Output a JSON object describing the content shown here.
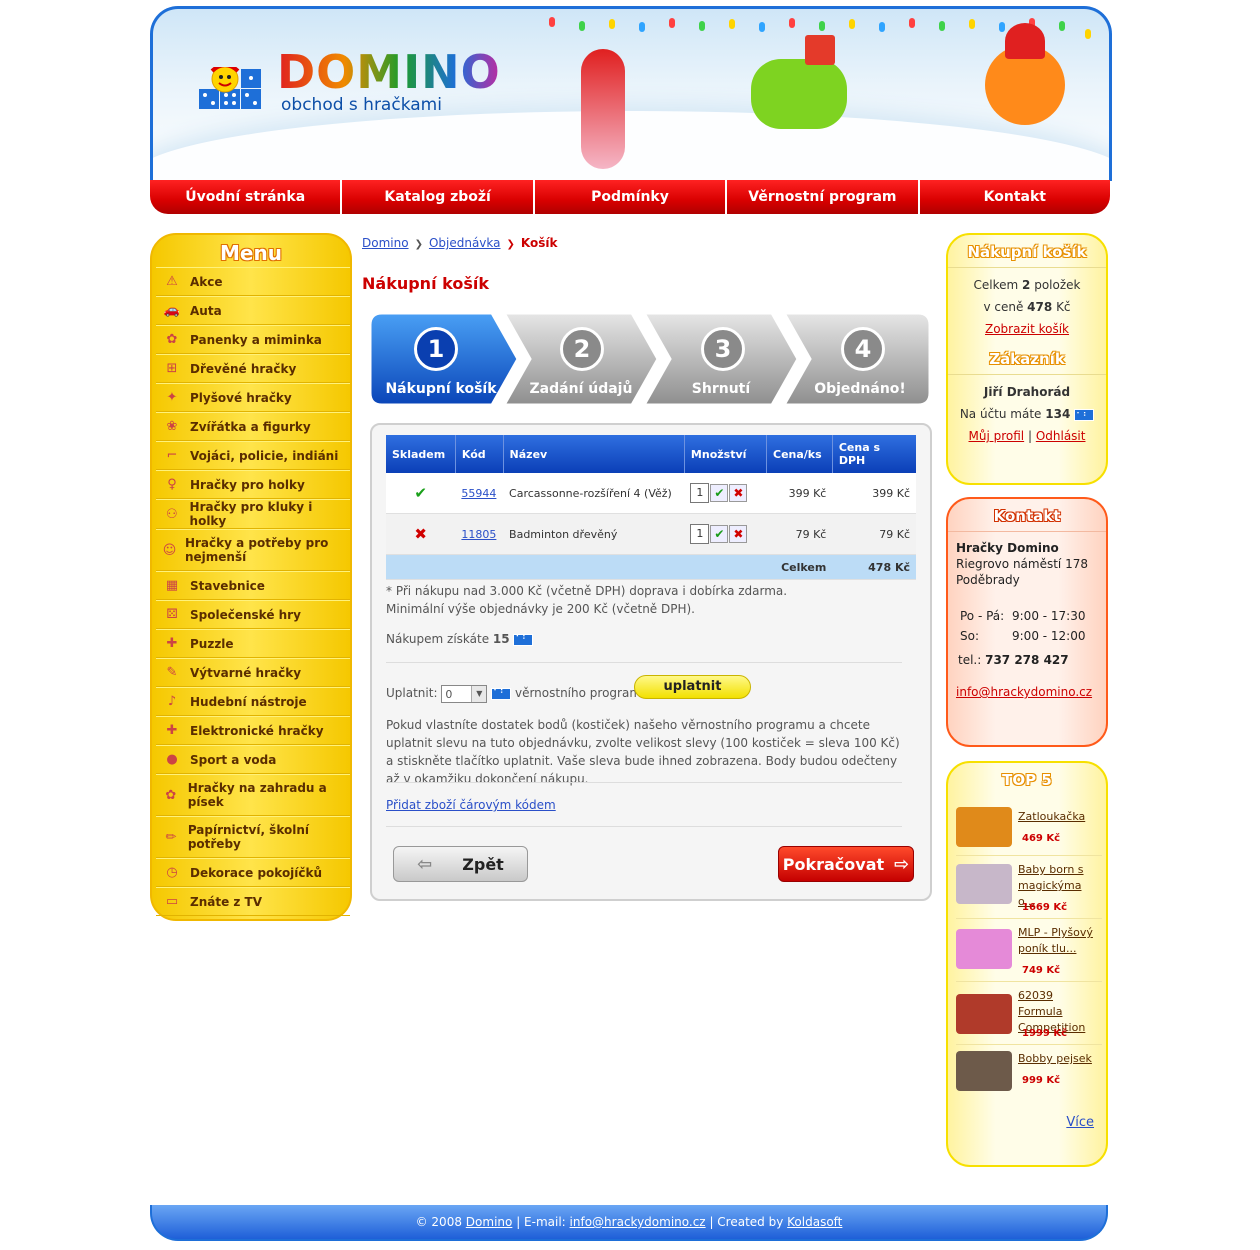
{
  "header": {
    "logo_title": "DOMINO",
    "logo_subtitle": "obchod s hračkami"
  },
  "nav": [
    {
      "label": "Úvodní stránka"
    },
    {
      "label": "Katalog zboží"
    },
    {
      "label": "Podmínky"
    },
    {
      "label": "Věrnostní program"
    },
    {
      "label": "Kontakt"
    }
  ],
  "menu": {
    "title": "Menu",
    "items": [
      {
        "label": "Akce",
        "icon": "warning-icon"
      },
      {
        "label": "Auta",
        "icon": "car-icon"
      },
      {
        "label": "Panenky a miminka",
        "icon": "doll-icon"
      },
      {
        "label": "Dřevěné hračky",
        "icon": "train-icon"
      },
      {
        "label": "Plyšové hračky",
        "icon": "teddy-icon"
      },
      {
        "label": "Zvířátka a figurky",
        "icon": "animal-icon"
      },
      {
        "label": "Vojáci, policie, indiáni",
        "icon": "gun-icon"
      },
      {
        "label": "Hračky pro holky",
        "icon": "girl-icon"
      },
      {
        "label": "Hračky pro kluky i holky",
        "icon": "kids-icon"
      },
      {
        "label": "Hračky a potřeby pro nejmenší",
        "icon": "baby-icon"
      },
      {
        "label": "Stavebnice",
        "icon": "blocks-icon"
      },
      {
        "label": "Společenské hry",
        "icon": "dice-icon"
      },
      {
        "label": "Puzzle",
        "icon": "puzzle-icon"
      },
      {
        "label": "Výtvarné hračky",
        "icon": "palette-icon"
      },
      {
        "label": "Hudební nástroje",
        "icon": "music-icon"
      },
      {
        "label": "Elektronické hračky",
        "icon": "electronic-icon"
      },
      {
        "label": "Sport a voda",
        "icon": "ball-icon"
      },
      {
        "label": "Hračky na zahradu a písek",
        "icon": "garden-icon"
      },
      {
        "label": "Papírnictví, školní potřeby",
        "icon": "pencil-icon"
      },
      {
        "label": "Dekorace pokojíčků",
        "icon": "clock-icon"
      },
      {
        "label": "Znáte z TV",
        "icon": "tv-icon"
      }
    ]
  },
  "breadcrumb": {
    "items": [
      "Domino",
      "Objednávka"
    ],
    "current": "Košík"
  },
  "page_title": "Nákupní košík",
  "steps": [
    {
      "num": "1",
      "label": "Nákupní košík",
      "active": true
    },
    {
      "num": "2",
      "label": "Zadání údajů",
      "active": false
    },
    {
      "num": "3",
      "label": "Shrnutí",
      "active": false
    },
    {
      "num": "4",
      "label": "Objednáno!",
      "active": false
    }
  ],
  "cart": {
    "columns": [
      "Skladem",
      "Kód",
      "Název",
      "Množství",
      "Cena/ks",
      "Cena s DPH"
    ],
    "rows": [
      {
        "in_stock": true,
        "code": "55944",
        "name": "Carcassonne-rozšíření 4 (Věž)",
        "qty": "1",
        "unit_price": "399 Kč",
        "price_vat": "399 Kč"
      },
      {
        "in_stock": false,
        "code": "11805",
        "name": "Badminton dřevěný",
        "qty": "1",
        "unit_price": "79 Kč",
        "price_vat": "79 Kč"
      }
    ],
    "total_label": "Celkem",
    "total_value": "478 Kč",
    "note_line1": "* Při nákupu nad 3.000 Kč (včetně DPH) doprava i dobírka zdarma.",
    "note_line2": "Minimální výše objednávky je 200 Kč (včetně DPH).",
    "points_text": "Nákupem získáte",
    "points_value": "15",
    "redeem_label": "Uplatnit:",
    "redeem_value": "0",
    "redeem_suffix": "věrnostního programu",
    "redeem_button": "uplatnit",
    "redeem_info": "Pokud vlastníte dostatek bodů (kostiček) našeho věrnostního programu a chcete uplatnit slevu na tuto objednávku, zvolte velikost slevy (100 kostiček = sleva 100 Kč) a stiskněte tlačítko uplatnit. Vaše sleva bude ihned zobrazena. Body budou odečteny až v okamžiku dokončení nákupu.",
    "barcode_link": "Přidat zboží čárovým kódem",
    "back_button": "Zpět",
    "next_button": "Pokračovat"
  },
  "cart_box": {
    "title": "Nákupní košík",
    "line1_pre": "Celkem",
    "line1_count": "2",
    "line1_post": "položek",
    "line2_pre": "v ceně",
    "line2_price": "478",
    "line2_post": "Kč",
    "link": "Zobrazit košík"
  },
  "customer_box": {
    "title": "Zákazník",
    "name": "Jiří Drahorád",
    "points_pre": "Na účtu máte",
    "points_value": "134",
    "profile_link": "Můj profil",
    "logout_link": "Odhlásit"
  },
  "contact_box": {
    "title": "Kontakt",
    "company": "Hračky Domino",
    "street": "Riegrovo náměstí 178",
    "city": "Poděbrady",
    "hours1_days": "Po - Pá:",
    "hours1_time": "9:00 - 17:30",
    "hours2_days": "So:",
    "hours2_time": "9:00 - 12:00",
    "phone_label": "tel.:",
    "phone": "737 278 427",
    "email": "info@hrackydomino.cz"
  },
  "top5": {
    "title": "TOP 5",
    "items": [
      {
        "name": "Zatloukačka",
        "price": "469 Kč",
        "color": "#e08a1a"
      },
      {
        "name": "Baby born s magickýma o...",
        "price": "1669 Kč",
        "color": "#c7b7c9"
      },
      {
        "name": "MLP - Plyšový poník tlu...",
        "price": "749 Kč",
        "color": "#e58ad8"
      },
      {
        "name": "62039 Formula Competition",
        "price": "1999 Kč",
        "color": "#b03a2a"
      },
      {
        "name": "Bobby pejsek",
        "price": "999 Kč",
        "color": "#6d5a4a"
      }
    ],
    "more": "Více"
  },
  "footer": {
    "copyright": "© 2008",
    "site_link": "Domino",
    "email_label": "| E-mail:",
    "email": "info@hrackydomino.cz",
    "created_label": "| Created by",
    "creator": "Koldasoft"
  }
}
